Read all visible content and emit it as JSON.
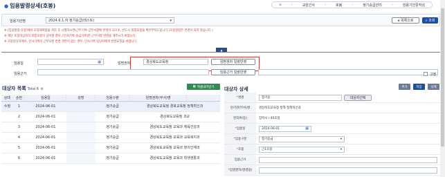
{
  "page_title": "임용발령상세(호봉)",
  "breadcrumbs": [
    "교원인사",
    "호봉",
    "정기승급관리",
    "임용기안문작성"
  ],
  "search": {
    "label": "임용기안명",
    "value": "2024.6.1.자 정기승급(테스트)",
    "back_label": "목록으로",
    "search_label": "조회"
  },
  "notes": [
    "※ [임용발령-호봉]에서 호봉재획정을 처리 후 시행하시면(근무기록-근무사항에 반영이 되므로, 반드시 최종호봉을 확인부탁드립니다.(호봉정정은 반영이 되지 않습니다.)",
    "※ 해당 호봉대상자의 최종호봉이 상이할 경우, [인사기록-승급기록]란 근무사항 반영을 해주시기 바랍니다.",
    "※ 호봉담당자에서, 인사기록의 근무사항 반영 권한이 없는 경우, 인사기록 담당자에게 반영요청을 바랍니다."
  ],
  "apply": {
    "appoint_date_label": "임용일",
    "appoint_date_value": "",
    "appointer_label": "임명권자",
    "appointer_value": "경상북도교육청",
    "appointer_bulk_label": "임명권자 일괄반영",
    "basis_label": "임용근거",
    "basis_value": "",
    "basis_bulk_label": "임용근거 일괄반영",
    "fixed_label": "고정"
  },
  "targets": {
    "title": "대상자 목록",
    "total": "Total 6",
    "excel_label": "엑셀내려받기",
    "columns": [
      "상태",
      "순번",
      "임용일",
      "성명",
      "임용구분",
      "임명권자(부서)명"
    ],
    "rows": [
      {
        "status": "수정",
        "no": "1",
        "date": "2024-06-01",
        "name": "",
        "type": "정기승급",
        "org": "경상북도교육청 경북교육청 정책혁신과"
      },
      {
        "status": "",
        "no": "2",
        "date": "2024-06-01",
        "name": "",
        "type": "정기승급",
        "org": "경상북도교육청           과교"
      },
      {
        "status": "",
        "no": "3",
        "date": "2024-06-01",
        "name": "",
        "type": "정기승급",
        "org": "경상북도교육청 교육과 체육건강과"
      },
      {
        "status": "",
        "no": "4",
        "date": "2024-06-01",
        "name": "",
        "type": "정기승급",
        "org": "경상북도교육청 교육과 교육복지과"
      },
      {
        "status": "",
        "no": "5",
        "date": "2024-06-01",
        "name": "",
        "type": "정기승급",
        "org": "경상북도교육청 교육과 창의인재과"
      },
      {
        "status": "",
        "no": "6",
        "date": "2024-06-01",
        "name": "",
        "type": "정기승급",
        "org": "경상북도교육청 교육과 학생생활과"
      }
    ]
  },
  "detail": {
    "title": "대상자 상세",
    "add_label": "추가",
    "save_label": "저장",
    "delete_label": "삭제",
    "name_label": "성명",
    "name_value": "정기승",
    "select_target_label": "대상자선택",
    "dept_label": "현기관(부서)명",
    "dept_value": "경상북도교육청 정책 정책혁신과",
    "rank_label": "현직위(등)",
    "rank_value": "장학사 / 40호봉",
    "date_label": "임용일",
    "date_value": "2024-06-01",
    "type_label": "임용구분",
    "type_value": "정기승급",
    "grade_label": "호봉",
    "grade_value": "근1호봉",
    "basis_label": "임용근거",
    "basis_value": "",
    "appointer_label": "임명권자(발령용)",
    "appointer_value": ""
  }
}
